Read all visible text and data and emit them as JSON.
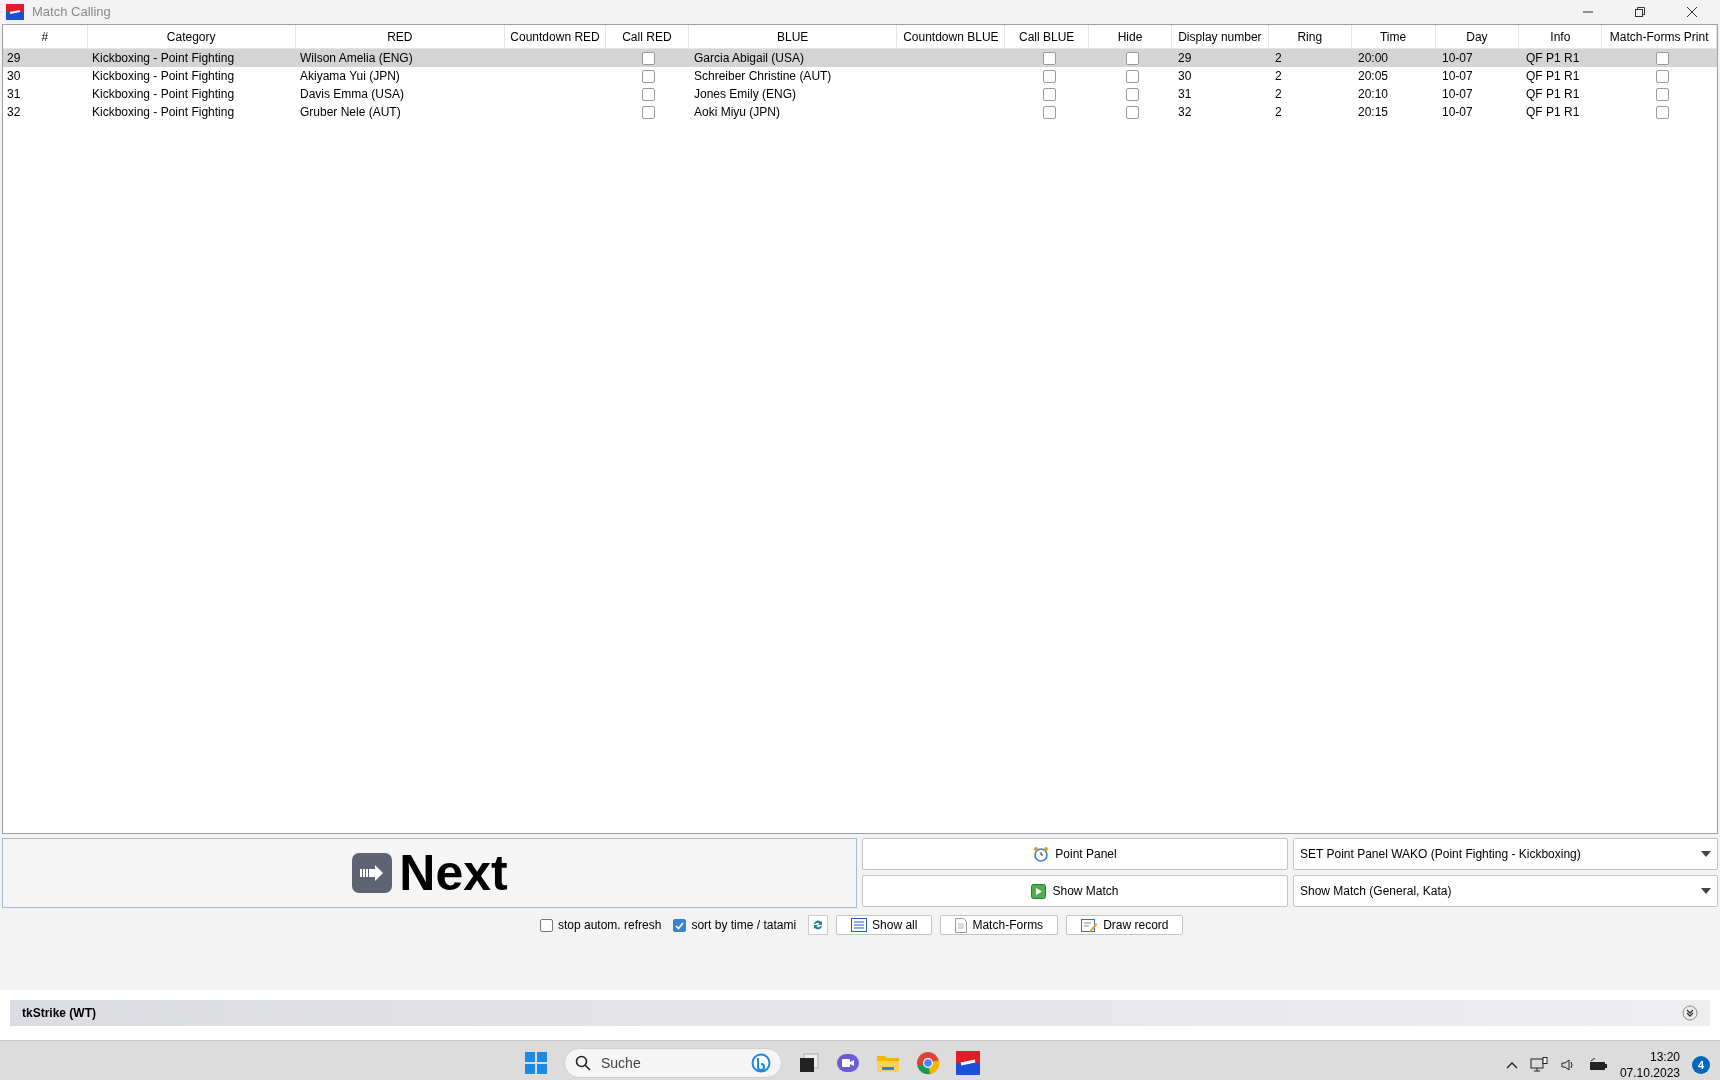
{
  "window": {
    "title": "Match Calling"
  },
  "table": {
    "columns": [
      "#",
      "Category",
      "RED",
      "Countdown RED",
      "Call RED",
      "BLUE",
      "Countdown BLUE",
      "Call BLUE",
      "Hide",
      "Display number",
      "Ring",
      "Time",
      "Day",
      "Info",
      "Match-Forms Print"
    ],
    "rows": [
      {
        "selected": true,
        "number": "29",
        "category": "Kickboxing - Point Fighting",
        "red": "Wilson Amelia (ENG)",
        "call_red": false,
        "blue": "Garcia Abigail (USA)",
        "call_blue": false,
        "hide": false,
        "display_number": "29",
        "ring": "2",
        "time": "20:00",
        "day": "10-07",
        "info": "QF P1 R1",
        "forms_print": false
      },
      {
        "selected": false,
        "number": "30",
        "category": "Kickboxing - Point Fighting",
        "red": "Akiyama Yui (JPN)",
        "call_red": false,
        "blue": "Schreiber Christine (AUT)",
        "call_blue": false,
        "hide": false,
        "display_number": "30",
        "ring": "2",
        "time": "20:05",
        "day": "10-07",
        "info": "QF P1 R1",
        "forms_print": false
      },
      {
        "selected": false,
        "number": "31",
        "category": "Kickboxing - Point Fighting",
        "red": "Davis Emma (USA)",
        "call_red": false,
        "blue": "Jones Emily (ENG)",
        "call_blue": false,
        "hide": false,
        "display_number": "31",
        "ring": "2",
        "time": "20:10",
        "day": "10-07",
        "info": "QF P1 R1",
        "forms_print": false
      },
      {
        "selected": false,
        "number": "32",
        "category": "Kickboxing - Point Fighting",
        "red": "Gruber Nele (AUT)",
        "call_red": false,
        "blue": "Aoki Miyu (JPN)",
        "call_blue": false,
        "hide": false,
        "display_number": "32",
        "ring": "2",
        "time": "20:15",
        "day": "10-07",
        "info": "QF P1 R1",
        "forms_print": false
      }
    ]
  },
  "next_button": {
    "label": "Next"
  },
  "panel_buttons": [
    {
      "label": "Point Panel",
      "dropdown": "SET Point Panel WAKO (Point Fighting - Kickboxing)"
    },
    {
      "label": "Show Match",
      "dropdown": "Show Match (General, Kata)"
    }
  ],
  "options": [
    {
      "label": "stop autom. refresh",
      "checked": false
    },
    {
      "label": "sort by time / tatami",
      "checked": true
    }
  ],
  "tool_buttons": [
    "Show all",
    "Match-Forms",
    "Draw record"
  ],
  "collapsed_panel": {
    "title": "tkStrike (WT)"
  },
  "taskbar": {
    "search_placeholder": "Suche",
    "time": "13:20",
    "date": "07.10.2023",
    "notification_count": "4"
  }
}
